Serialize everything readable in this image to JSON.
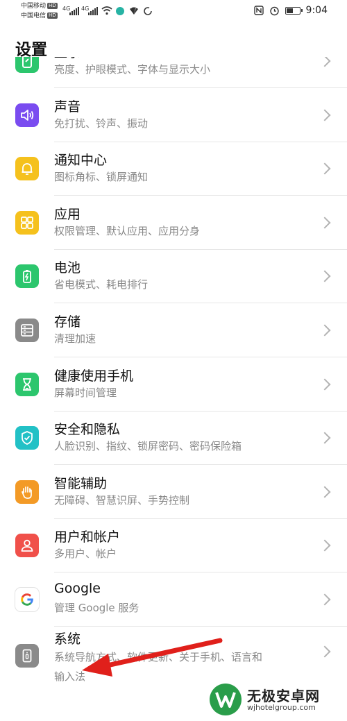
{
  "status_bar": {
    "carrier1": "中国移动",
    "carrier2": "中国电信",
    "hd": "HD",
    "net1": "4G",
    "net2": "4G",
    "battery_level": 0.55,
    "time": "9:04"
  },
  "page": {
    "title": "设置"
  },
  "items": [
    {
      "label": "显示",
      "sub": "亮度、护眼模式、字体与显示大小",
      "icon": "display-icon",
      "color": "#2cc66d"
    },
    {
      "label": "声音",
      "sub": "免打扰、铃声、振动",
      "icon": "sound-icon",
      "color": "#7a4cf0"
    },
    {
      "label": "通知中心",
      "sub": "图标角标、锁屏通知",
      "icon": "bell-icon",
      "color": "#f5c11d"
    },
    {
      "label": "应用",
      "sub": "权限管理、默认应用、应用分身",
      "icon": "apps-grid-icon",
      "color": "#f5c11d"
    },
    {
      "label": "电池",
      "sub": "省电模式、耗电排行",
      "icon": "battery-icon",
      "color": "#2cc66d"
    },
    {
      "label": "存储",
      "sub": "清理加速",
      "icon": "storage-icon",
      "color": "#8a8a8a"
    },
    {
      "label": "健康使用手机",
      "sub": "屏幕时间管理",
      "icon": "hourglass-icon",
      "color": "#2cc66d"
    },
    {
      "label": "安全和隐私",
      "sub": "人脸识别、指纹、锁屏密码、密码保险箱",
      "icon": "shield-icon",
      "color": "#22c1c6"
    },
    {
      "label": "智能辅助",
      "sub": "无障碍、智慧识屏、手势控制",
      "icon": "hand-icon",
      "color": "#f39a26"
    },
    {
      "label": "用户和帐户",
      "sub": "多用户、帐户",
      "icon": "user-icon",
      "color": "#f0504a"
    },
    {
      "label": "Google",
      "sub": "管理 Google 服务",
      "icon": "google-icon",
      "color": "#ffffff"
    },
    {
      "label": "系统",
      "sub": "系统导航方式、软件更新、关于手机、语言和",
      "sub2": "输入法",
      "icon": "system-phone-icon",
      "color": "#8a8a8a"
    }
  ],
  "watermark": {
    "name": "无极安卓网",
    "url": "wjhotelgroup.com"
  }
}
